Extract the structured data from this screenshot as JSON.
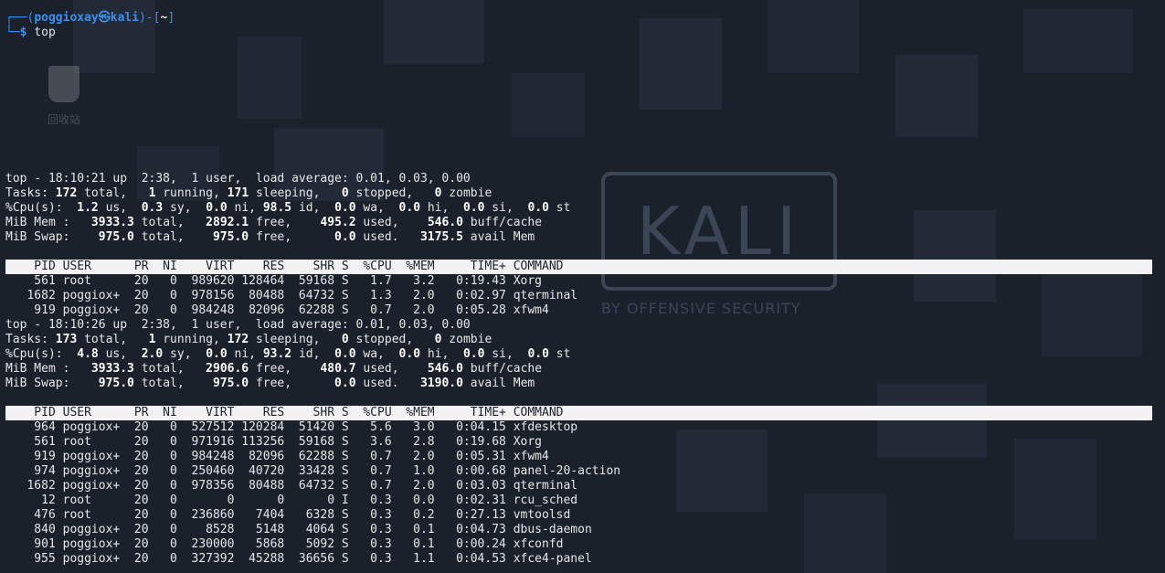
{
  "desktop": {
    "trash_label": "回收站",
    "watermark_logo": "KALI",
    "watermark_sub": "BY OFFENSIVE SECURITY"
  },
  "prompt": {
    "frame_left": "┌──(",
    "user": "poggioxay㉿kali",
    "frame_mid": ")-[",
    "path": "~",
    "frame_right": "]",
    "frame_bottom": "└─",
    "dollar": "$",
    "command": " top"
  },
  "snapshots": [
    {
      "summary": {
        "top": "top - 18:10:21 up  2:38,  1 user,  load average: 0.01, 0.03, 0.00",
        "tasks": {
          "label": "Tasks: ",
          "total": "172",
          "t1": " total,   ",
          "running": "1",
          "t2": " running, ",
          "sleeping": "171",
          "t3": " sleeping,   ",
          "stopped": "0",
          "t4": " stopped,   ",
          "zombie": "0",
          "t5": " zombie"
        },
        "cpu": {
          "label": "%Cpu(s):  ",
          "us": "1.2",
          "t1": " us,  ",
          "sy": "0.3",
          "t2": " sy,  ",
          "ni": "0.0",
          "t3": " ni, ",
          "id": "98.5",
          "t4": " id,  ",
          "wa": "0.0",
          "t5": " wa,  ",
          "hi": "0.0",
          "t6": " hi,  ",
          "si": "0.0",
          "t7": " si,  ",
          "st": "0.0",
          "t8": " st"
        },
        "mem": {
          "label": "MiB Mem :   ",
          "total": "3933.3",
          "t1": " total,   ",
          "free": "2892.1",
          "t2": " free,    ",
          "used": "495.2",
          "t3": " used,    ",
          "buff": "546.0",
          "t4": " buff/cache"
        },
        "swap": {
          "label": "MiB Swap:    ",
          "total": "975.0",
          "t1": " total,    ",
          "free": "975.0",
          "t2": " free,      ",
          "used": "0.0",
          "t3": " used.   ",
          "avail": "3175.5",
          "t4": " avail Mem"
        }
      },
      "header": "    PID USER      PR  NI    VIRT    RES    SHR S  %CPU  %MEM     TIME+ COMMAND",
      "rows": [
        "    561 root      20   0  989620 128464  59168 S   1.7   3.2   0:19.43 Xorg",
        "   1682 poggiox+  20   0  978156  80488  64732 S   1.3   2.0   0:02.97 qterminal",
        "    919 poggiox+  20   0  984248  82096  62288 S   0.7   2.0   0:05.28 xfwm4"
      ]
    },
    {
      "summary": {
        "top": "top - 18:10:26 up  2:38,  1 user,  load average: 0.01, 0.03, 0.00",
        "tasks": {
          "label": "Tasks: ",
          "total": "173",
          "t1": " total,   ",
          "running": "1",
          "t2": " running, ",
          "sleeping": "172",
          "t3": " sleeping,   ",
          "stopped": "0",
          "t4": " stopped,   ",
          "zombie": "0",
          "t5": " zombie"
        },
        "cpu": {
          "label": "%Cpu(s):  ",
          "us": "4.8",
          "t1": " us,  ",
          "sy": "2.0",
          "t2": " sy,  ",
          "ni": "0.0",
          "t3": " ni, ",
          "id": "93.2",
          "t4": " id,  ",
          "wa": "0.0",
          "t5": " wa,  ",
          "hi": "0.0",
          "t6": " hi,  ",
          "si": "0.0",
          "t7": " si,  ",
          "st": "0.0",
          "t8": " st"
        },
        "mem": {
          "label": "MiB Mem :   ",
          "total": "3933.3",
          "t1": " total,   ",
          "free": "2906.6",
          "t2": " free,    ",
          "used": "480.7",
          "t3": " used,    ",
          "buff": "546.0",
          "t4": " buff/cache"
        },
        "swap": {
          "label": "MiB Swap:    ",
          "total": "975.0",
          "t1": " total,    ",
          "free": "975.0",
          "t2": " free,      ",
          "used": "0.0",
          "t3": " used.   ",
          "avail": "3190.0",
          "t4": " avail Mem"
        }
      },
      "header": "    PID USER      PR  NI    VIRT    RES    SHR S  %CPU  %MEM     TIME+ COMMAND",
      "rows": [
        "    964 poggiox+  20   0  527512 120284  51420 S   5.6   3.0   0:04.15 xfdesktop",
        "    561 root      20   0  971916 113256  59168 S   3.6   2.8   0:19.68 Xorg",
        "    919 poggiox+  20   0  984248  82096  62288 S   0.7   2.0   0:05.31 xfwm4",
        "    974 poggiox+  20   0  250460  40720  33428 S   0.7   1.0   0:00.68 panel-20-action",
        "   1682 poggiox+  20   0  978356  80488  64732 S   0.7   2.0   0:03.03 qterminal",
        "     12 root      20   0       0      0      0 I   0.3   0.0   0:02.31 rcu_sched",
        "    476 root      20   0  236860   7404   6328 S   0.3   0.2   0:27.13 vmtoolsd",
        "    840 poggiox+  20   0    8528   5148   4064 S   0.3   0.1   0:04.73 dbus-daemon",
        "    901 poggiox+  20   0  230000   5868   5092 S   0.3   0.1   0:00.24 xfconfd",
        "    955 poggiox+  20   0  327392  45288  36656 S   0.3   1.1   0:04.53 xfce4-panel"
      ]
    }
  ]
}
